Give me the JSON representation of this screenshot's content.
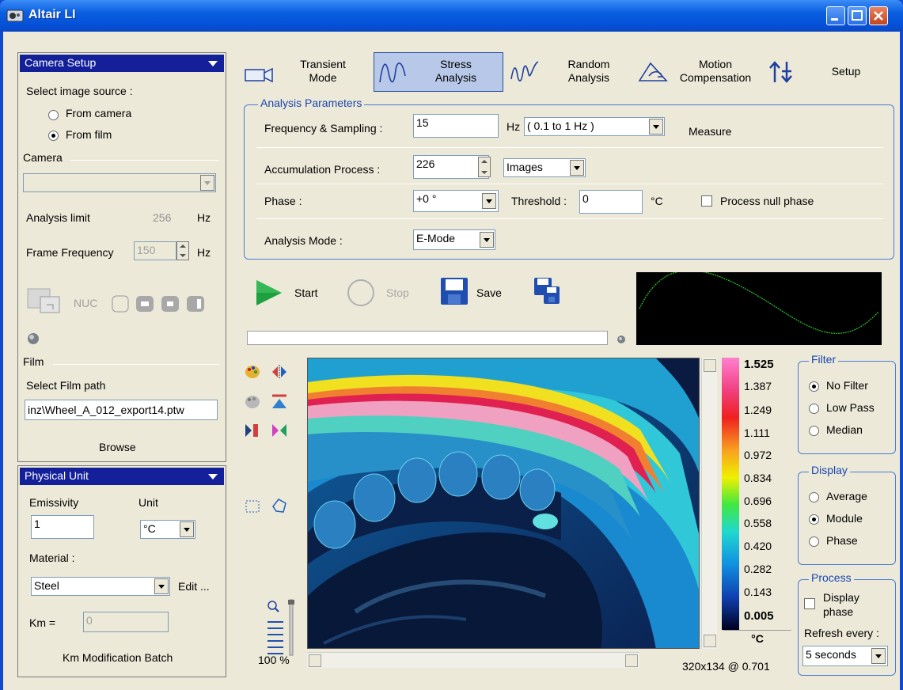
{
  "window": {
    "title": "Altair LI"
  },
  "camera_setup": {
    "header": "Camera Setup",
    "select_source_label": "Select image source :",
    "options": [
      "From camera",
      "From film"
    ],
    "selected": "From film",
    "camera_label": "Camera",
    "analysis_limit_label": "Analysis limit",
    "analysis_limit_value": "256",
    "analysis_limit_unit": "Hz",
    "frame_frequency_label": "Frame Frequency",
    "frame_frequency_value": "150",
    "frame_frequency_unit": "Hz",
    "nuc_label": "NUC",
    "film_label": "Film",
    "film_path_label": "Select Film path",
    "film_path_value": "inz\\Wheel_A_012_export14.ptw",
    "browse_label": "Browse"
  },
  "physical_unit": {
    "header": "Physical Unit",
    "emissivity_label": "Emissivity",
    "emissivity_value": "1",
    "unit_label": "Unit",
    "unit_value": "°C",
    "material_label": "Material :",
    "material_value": "Steel",
    "edit_label": "Edit ...",
    "km_label": "Km =",
    "km_value": "0",
    "km_batch_label": "Km Modification Batch"
  },
  "toolbar": {
    "modes": [
      {
        "line1": "Transient",
        "line2": "Mode"
      },
      {
        "line1": "Stress",
        "line2": "Analysis"
      },
      {
        "line1": "Random",
        "line2": "Analysis"
      },
      {
        "line1": "Motion",
        "line2": "Compensation"
      },
      {
        "line1": "Setup",
        "line2": ""
      }
    ],
    "selected_mode": "Stress Analysis"
  },
  "analysis_parameters": {
    "title": "Analysis Parameters",
    "freq_label": "Frequency  & Sampling :",
    "freq_value": "15",
    "freq_unit": "Hz",
    "freq_range": "( 0.1 to 1 Hz )",
    "measure_label": "Measure",
    "accum_label": "Accumulation Process :",
    "accum_value": "226",
    "accum_unit": "Images",
    "phase_label": "Phase :",
    "phase_value": "+0 °",
    "threshold_label": "Threshold :",
    "threshold_value": "0",
    "threshold_unit": "°C",
    "null_phase_label": "Process null phase",
    "mode_label": "Analysis Mode :",
    "mode_value": "E-Mode"
  },
  "controls": {
    "start_label": "Start",
    "stop_label": "Stop",
    "save_label": "Save"
  },
  "image_view": {
    "zoom": "100 %",
    "resolution": "320x134 @ 0.701",
    "unit": "°C",
    "scale_values": [
      "1.525",
      "1.387",
      "1.249",
      "1.111",
      "0.972",
      "0.834",
      "0.696",
      "0.558",
      "0.420",
      "0.282",
      "0.143",
      "0.005"
    ]
  },
  "filter": {
    "title": "Filter",
    "options": [
      "No Filter",
      "Low Pass",
      "Median"
    ],
    "selected": "No Filter"
  },
  "display": {
    "title": "Display",
    "options": [
      "Average",
      "Module",
      "Phase"
    ],
    "selected": "Module"
  },
  "process": {
    "title": "Process",
    "display_phase_line1": "Display",
    "display_phase_line2": "phase",
    "refresh_label": "Refresh every :",
    "refresh_value": "5 seconds"
  },
  "colors": {
    "title_bar": "#0a5fe0",
    "panel_header": "#13209a",
    "window_bg": "#ece9d8",
    "group_border": "#4b7bd4"
  }
}
